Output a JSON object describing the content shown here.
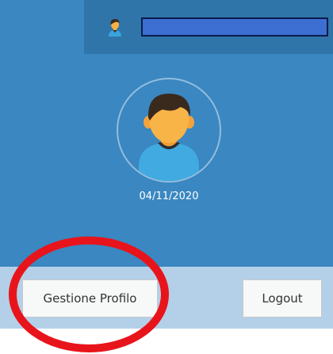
{
  "header": {
    "user_icon": "user-avatar-icon",
    "username_field_color": "#3d6fd2"
  },
  "profile": {
    "avatar_icon": "person-avatar-icon",
    "date": "04/11/2020"
  },
  "actions": {
    "profile_button_label": "Gestione Profilo",
    "logout_button_label": "Logout"
  },
  "annotation": {
    "type": "red-ellipse-highlight",
    "color": "#e8141c"
  },
  "colors": {
    "panel_blue": "#3a87c1",
    "header_blue": "#2f75a9",
    "strip_light_blue": "#b4d0e8"
  }
}
